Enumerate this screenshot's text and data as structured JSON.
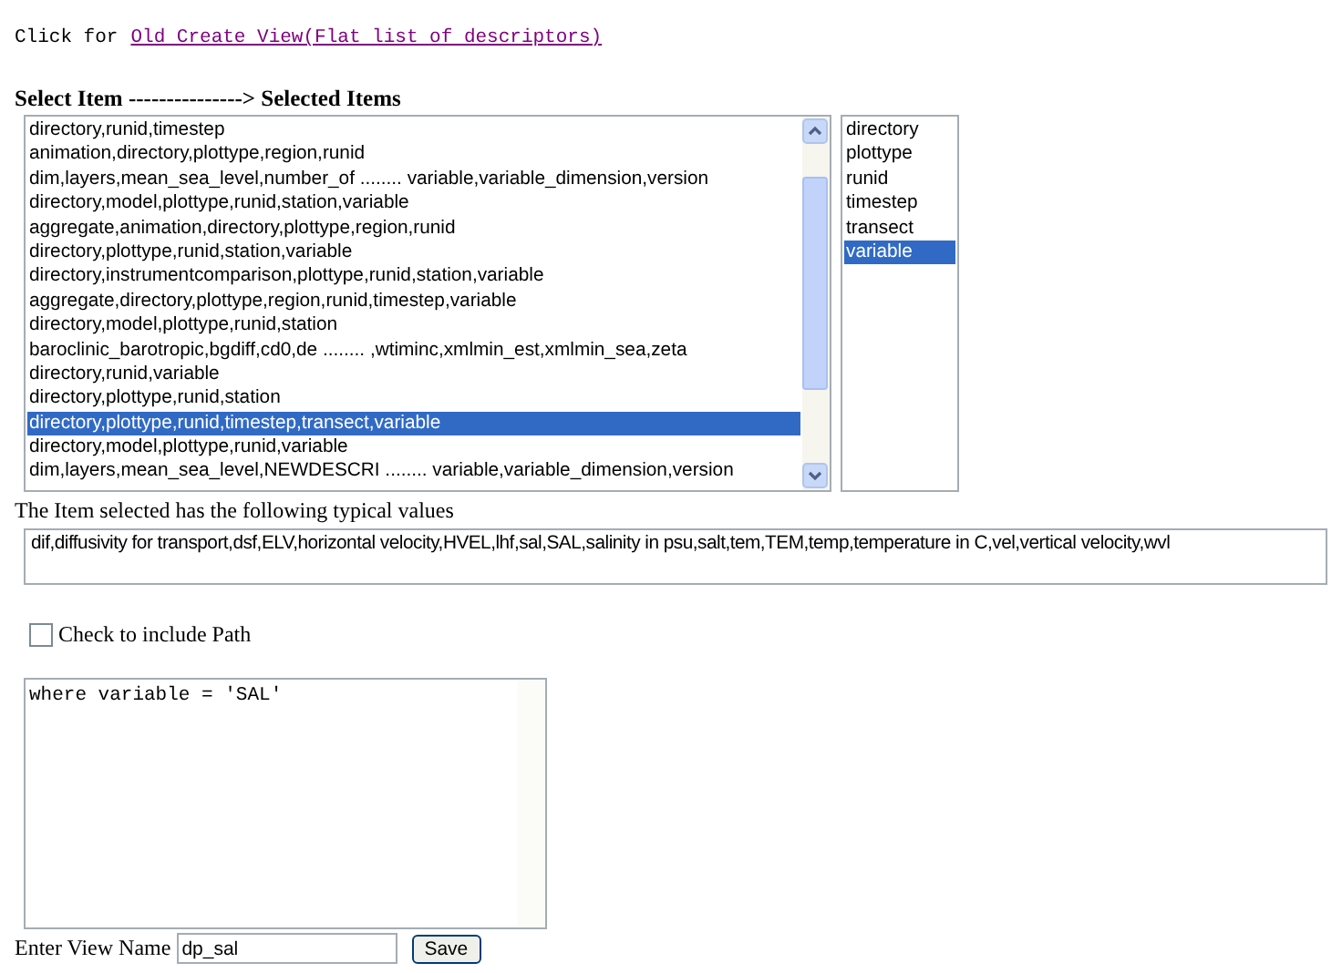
{
  "header": {
    "prefix": "Click for",
    "link": "Old Create View(Flat list of descriptors)"
  },
  "heading": "Select Item ---------------> Selected Items",
  "items": [
    {
      "label": "directory,runid,timestep",
      "selected": false
    },
    {
      "label": "animation,directory,plottype,region,runid",
      "selected": false
    },
    {
      "label": "dim,layers,mean_sea_level,number_of ........ variable,variable_dimension,version",
      "selected": false
    },
    {
      "label": "directory,model,plottype,runid,station,variable",
      "selected": false
    },
    {
      "label": "aggregate,animation,directory,plottype,region,runid",
      "selected": false
    },
    {
      "label": "directory,plottype,runid,station,variable",
      "selected": false
    },
    {
      "label": "directory,instrumentcomparison,plottype,runid,station,variable",
      "selected": false
    },
    {
      "label": "aggregate,directory,plottype,region,runid,timestep,variable",
      "selected": false
    },
    {
      "label": "directory,model,plottype,runid,station",
      "selected": false
    },
    {
      "label": "baroclinic_barotropic,bgdiff,cd0,de ........ ,wtiminc,xmlmin_est,xmlmin_sea,zeta",
      "selected": false
    },
    {
      "label": "directory,runid,variable",
      "selected": false
    },
    {
      "label": "directory,plottype,runid,station",
      "selected": false
    },
    {
      "label": "directory,plottype,runid,timestep,transect,variable",
      "selected": true
    },
    {
      "label": "directory,model,plottype,runid,variable",
      "selected": false
    },
    {
      "label": "dim,layers,mean_sea_level,NEWDESCRI ........ variable,variable_dimension,version",
      "selected": false
    }
  ],
  "selected_items": [
    {
      "label": "directory",
      "selected": false
    },
    {
      "label": "plottype",
      "selected": false
    },
    {
      "label": "runid",
      "selected": false
    },
    {
      "label": "timestep",
      "selected": false
    },
    {
      "label": "transect",
      "selected": false
    },
    {
      "label": "variable",
      "selected": true
    }
  ],
  "typical_label": "The Item selected has the following typical values",
  "typical_values": "dif,diffusivity for transport,dsf,ELV,horizontal velocity,HVEL,lhf,sal,SAL,salinity in psu,salt,tem,TEM,temp,temperature in C,vel,vertical velocity,wvl",
  "include_path": {
    "label": "Check to include Path",
    "checked": false
  },
  "query": "where variable = 'SAL'",
  "view_name": {
    "label": "Enter View Name",
    "value": "dp_sal"
  },
  "save_button": "Save"
}
